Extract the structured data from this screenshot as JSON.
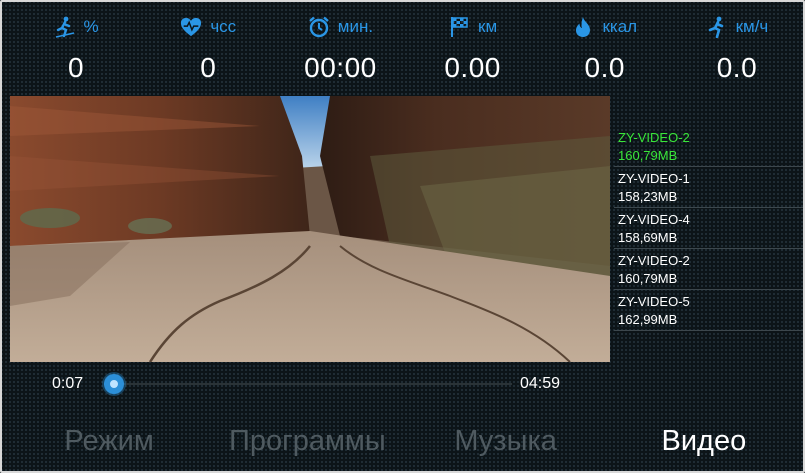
{
  "stats": [
    {
      "icon": "incline-runner-icon",
      "unit": "%",
      "value": "0"
    },
    {
      "icon": "heart-rate-icon",
      "unit": "чсс",
      "value": "0"
    },
    {
      "icon": "alarm-clock-icon",
      "unit": "мин.",
      "value": "00:00"
    },
    {
      "icon": "checkered-flag-icon",
      "unit": "км",
      "value": "0.00"
    },
    {
      "icon": "flame-icon",
      "unit": "ккал",
      "value": "0.0"
    },
    {
      "icon": "runner-icon",
      "unit": "км/ч",
      "value": "0.0"
    }
  ],
  "playlist": [
    {
      "name": "ZY-VIDEO-2",
      "size": "160,79MB",
      "active": true
    },
    {
      "name": "ZY-VIDEO-1",
      "size": "158,23MB",
      "active": false
    },
    {
      "name": "ZY-VIDEO-4",
      "size": "158,69MB",
      "active": false
    },
    {
      "name": "ZY-VIDEO-2",
      "size": "160,79MB",
      "active": false
    },
    {
      "name": "ZY-VIDEO-5",
      "size": "162,99MB",
      "active": false
    }
  ],
  "player": {
    "current_time": "0:07",
    "duration": "04:59",
    "progress_fraction": 0.02
  },
  "nav": {
    "tabs": [
      {
        "label": "Режим",
        "active": false
      },
      {
        "label": "Программы",
        "active": false
      },
      {
        "label": "Музыка",
        "active": false
      },
      {
        "label": "Видео",
        "active": true
      }
    ]
  },
  "colors": {
    "accent": "#2c8fd8",
    "active_item": "#39e639",
    "inactive_tab": "#4f5a60"
  }
}
